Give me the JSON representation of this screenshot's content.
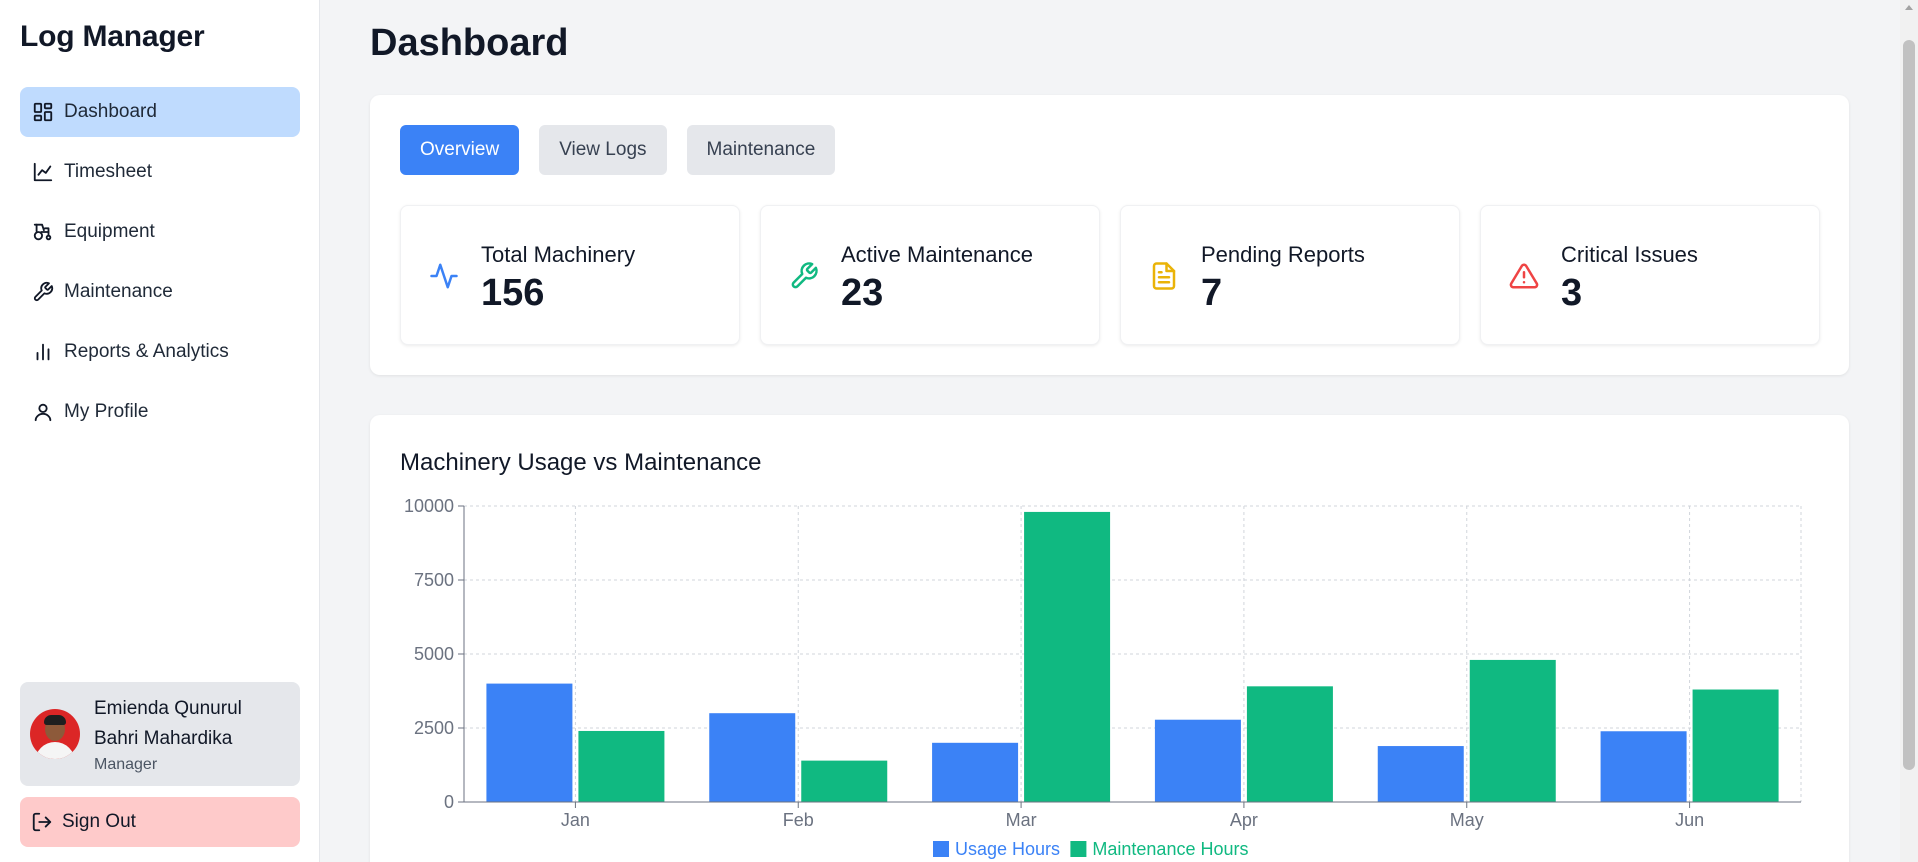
{
  "sidebar": {
    "brand": "Log Manager",
    "items": [
      {
        "label": "Dashboard",
        "icon": "layout-dashboard-icon",
        "active": true
      },
      {
        "label": "Timesheet",
        "icon": "line-chart-icon",
        "active": false
      },
      {
        "label": "Equipment",
        "icon": "tractor-icon",
        "active": false
      },
      {
        "label": "Maintenance",
        "icon": "wrench-icon",
        "active": false
      },
      {
        "label": "Reports & Analytics",
        "icon": "bar-chart-icon",
        "active": false
      },
      {
        "label": "My Profile",
        "icon": "user-icon",
        "active": false
      }
    ],
    "user": {
      "name": "Emienda Qunurul Bahri Mahardika",
      "role": "Manager"
    },
    "sign_out_label": "Sign Out"
  },
  "main": {
    "title": "Dashboard",
    "tabs": [
      {
        "label": "Overview",
        "active": true
      },
      {
        "label": "View Logs",
        "active": false
      },
      {
        "label": "Maintenance",
        "active": false
      }
    ],
    "stats": [
      {
        "label": "Total Machinery",
        "value": "156",
        "icon": "activity-icon",
        "color": "#3b82f6"
      },
      {
        "label": "Active Maintenance",
        "value": "23",
        "icon": "wrench-icon",
        "color": "#10b981"
      },
      {
        "label": "Pending Reports",
        "value": "7",
        "icon": "file-text-icon",
        "color": "#eab308"
      },
      {
        "label": "Critical Issues",
        "value": "3",
        "icon": "alert-triangle-icon",
        "color": "#ef4444"
      }
    ]
  },
  "chart_data": {
    "type": "bar",
    "title": "Machinery Usage vs Maintenance",
    "categories": [
      "Jan",
      "Feb",
      "Mar",
      "Apr",
      "May",
      "Jun"
    ],
    "series": [
      {
        "name": "Usage Hours",
        "color": "#3b82f6",
        "values": [
          4000,
          3000,
          2000,
          2780,
          1890,
          2390
        ]
      },
      {
        "name": "Maintenance Hours",
        "color": "#10b981",
        "values": [
          2400,
          1398,
          9800,
          3908,
          4800,
          3800
        ]
      }
    ],
    "yticks": [
      "0",
      "2500",
      "5000",
      "7500",
      "10000"
    ],
    "ylim": [
      0,
      10000
    ],
    "grid": true,
    "legend": "bottom-center"
  },
  "colors": {
    "accent": "#3b82f6",
    "active_nav": "#bfdbfe",
    "sign_out": "#fecaca"
  }
}
